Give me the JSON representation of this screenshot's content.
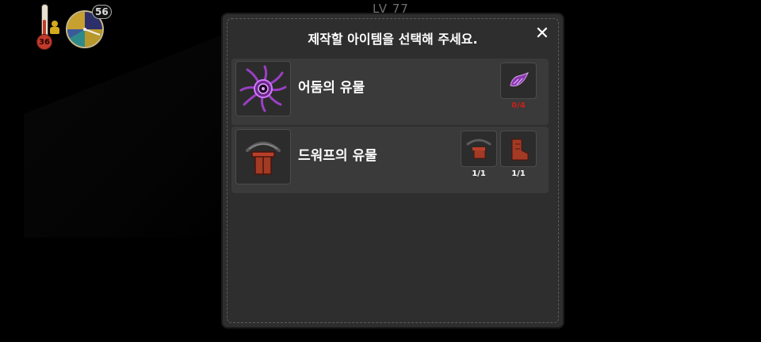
{
  "hud": {
    "level_text": "LV 77",
    "temperature": "36",
    "clock_number": "56",
    "icons": [
      "thermometer-icon",
      "person-icon",
      "day-clock-icon"
    ]
  },
  "modal": {
    "title": "제작할 아이템을 선택해 주세요.",
    "close_label": "✕",
    "items": [
      {
        "name": "어둠의 유물",
        "icon": "dark-relic-icon",
        "materials": [
          {
            "icon": "purple-wing-material-icon",
            "count": "0/4",
            "status": "short"
          }
        ]
      },
      {
        "name": "드워프의 유물",
        "icon": "dwarf-relic-icon",
        "materials": [
          {
            "icon": "pickaxe-material-icon",
            "count": "1/1",
            "status": "ok"
          },
          {
            "icon": "boot-material-icon",
            "count": "1/1",
            "status": "ok"
          }
        ]
      }
    ]
  },
  "colors": {
    "modal_bg": "#2e2e2e",
    "row_bg": "#3a3a3a",
    "count_ok": "#ffffff",
    "count_short": "#c8201a",
    "relic_purple": "#b14fd8",
    "relic_red": "#b8402a"
  }
}
